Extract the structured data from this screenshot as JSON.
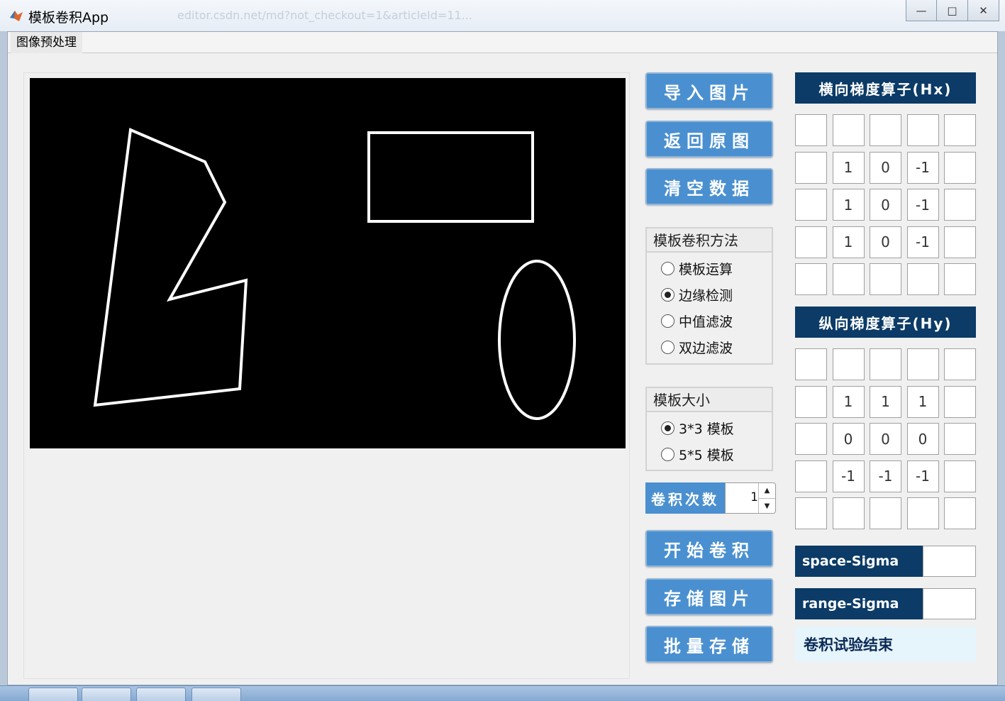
{
  "window": {
    "title": "模板卷积App",
    "ghost_url": "editor.csdn.net/md?not_checkout=1&articleId=11...",
    "controls": [
      "—",
      "□",
      "✕"
    ]
  },
  "menu": {
    "items": [
      "图像预处理"
    ]
  },
  "buttons": {
    "import": "导入图片",
    "restore": "返回原图",
    "clear": "清空数据",
    "start": "开始卷积",
    "save": "存储图片",
    "batch_save": "批量存储"
  },
  "method_group": {
    "title": "模板卷积方法",
    "options": [
      "模板运算",
      "边缘检测",
      "中值滤波",
      "双边滤波"
    ],
    "selected_index": 1
  },
  "size_group": {
    "title": "模板大小",
    "options": [
      "3*3 模板",
      "5*5 模板"
    ],
    "selected_index": 0
  },
  "conv_count": {
    "label": "卷积次数",
    "value": "1"
  },
  "hx": {
    "title": "横向梯度算子(Hx)",
    "cells": [
      [
        "",
        "",
        "",
        "",
        ""
      ],
      [
        "",
        "1",
        "0",
        "-1",
        ""
      ],
      [
        "",
        "1",
        "0",
        "-1",
        ""
      ],
      [
        "",
        "1",
        "0",
        "-1",
        ""
      ],
      [
        "",
        "",
        "",
        "",
        ""
      ]
    ]
  },
  "hy": {
    "title": "纵向梯度算子(Hy)",
    "cells": [
      [
        "",
        "",
        "",
        "",
        ""
      ],
      [
        "",
        "1",
        "1",
        "1",
        ""
      ],
      [
        "",
        "0",
        "0",
        "0",
        ""
      ],
      [
        "",
        "-1",
        "-1",
        "-1",
        ""
      ],
      [
        "",
        "",
        "",
        "",
        ""
      ]
    ]
  },
  "sigma": {
    "space_label": "space-Sigma",
    "space_value": "",
    "range_label": "range-Sigma",
    "range_value": ""
  },
  "status": "卷积试验结束",
  "colors": {
    "button_blue": "#4a90d0",
    "header_navy": "#0b3b66",
    "status_bg": "#e6f5fb"
  }
}
